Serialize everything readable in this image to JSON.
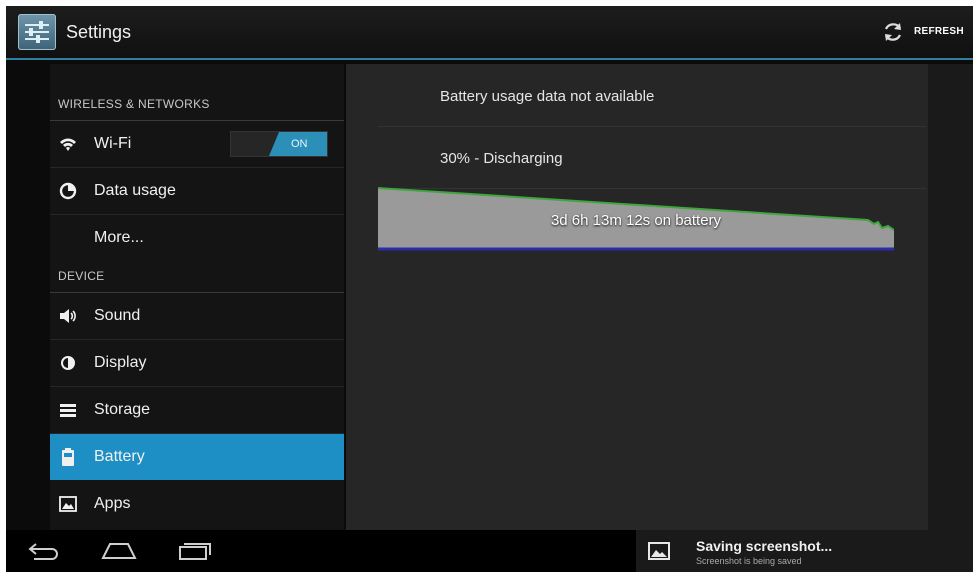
{
  "app": {
    "title": "Settings",
    "refresh_label": "REFRESH"
  },
  "sidebar": {
    "sections": [
      {
        "label": "WIRELESS & NETWORKS"
      },
      {
        "label": "DEVICE"
      }
    ],
    "items": [
      {
        "label": "Wi-Fi",
        "icon": "wifi-icon",
        "toggle": "ON"
      },
      {
        "label": "Data usage",
        "icon": "data-usage-icon"
      },
      {
        "label": "More...",
        "icon": ""
      },
      {
        "label": "Sound",
        "icon": "speaker-icon"
      },
      {
        "label": "Display",
        "icon": "brightness-icon"
      },
      {
        "label": "Storage",
        "icon": "storage-icon"
      },
      {
        "label": "Battery",
        "icon": "battery-icon",
        "selected": true
      },
      {
        "label": "Apps",
        "icon": "apps-icon"
      }
    ]
  },
  "battery": {
    "usage_text": "Battery usage data not available",
    "status_text": "30% - Discharging",
    "graph_label": "3d 6h 13m 12s on battery"
  },
  "notification": {
    "title": "Saving screenshot...",
    "subtitle": "Screenshot is being saved"
  },
  "colors": {
    "accent": "#1d8fc5",
    "graph_line": "#3fa53f",
    "graph_base": "#2c2ca8"
  }
}
